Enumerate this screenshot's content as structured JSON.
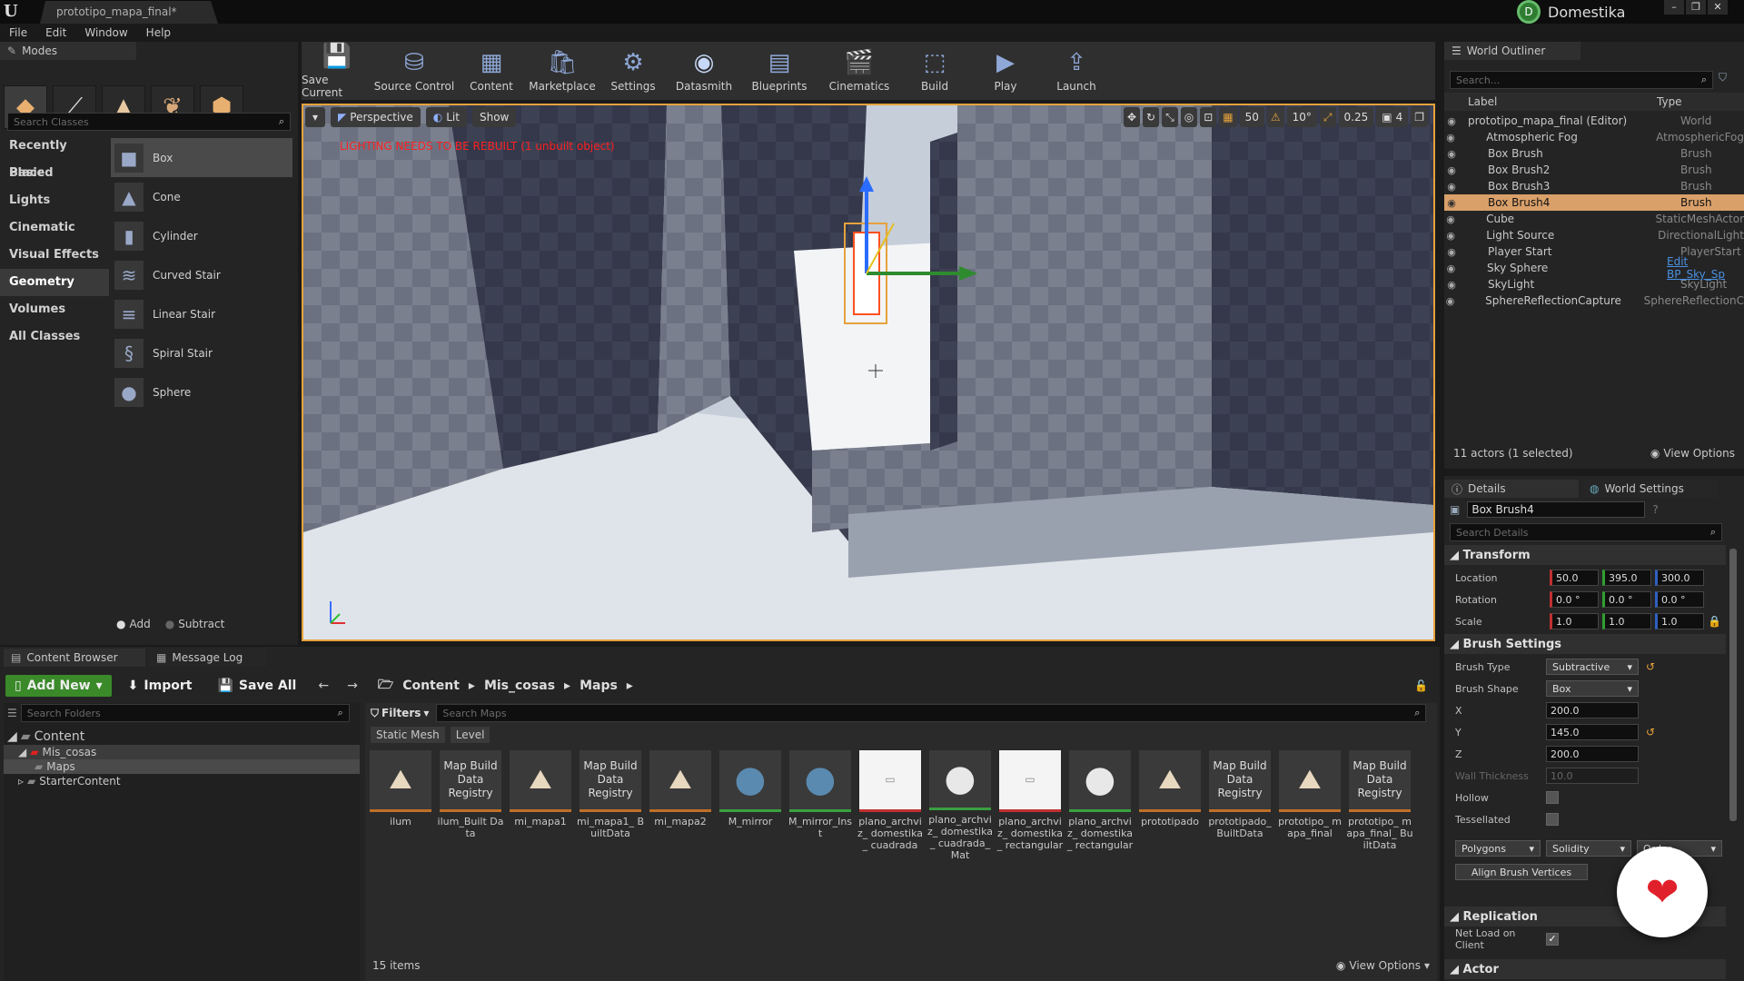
{
  "window": {
    "tab_title": "prototipo_mapa_final*",
    "brand": "Domestika",
    "brand_logo": "D",
    "logo": "U"
  },
  "menu": [
    "File",
    "Edit",
    "Window",
    "Help"
  ],
  "modes": {
    "tab": "Modes",
    "search_placeholder": "Search Classes",
    "categories": [
      "Recently Placed",
      "Basic",
      "Lights",
      "Cinematic",
      "Visual Effects",
      "Geometry",
      "Volumes",
      "All Classes"
    ],
    "active_category": "Geometry",
    "items": [
      "Box",
      "Cone",
      "Cylinder",
      "Curved Stair",
      "Linear Stair",
      "Spiral Stair",
      "Sphere"
    ],
    "add_label": "Add",
    "subtract_label": "Subtract"
  },
  "toolbar": {
    "buttons": [
      "Save Current",
      "Source Control",
      "Content",
      "Marketplace",
      "Settings",
      "Datasmith",
      "Blueprints",
      "Cinematics",
      "Build",
      "Play",
      "Launch"
    ]
  },
  "viewport": {
    "perspective": "Perspective",
    "lit": "Lit",
    "show": "Show",
    "warning": "LIGHTING NEEDS TO BE REBUILT (1 unbuilt object)",
    "grid_snap": "50",
    "rotation_snap": "10°",
    "scale_snap": "0.25",
    "camera_speed": "4"
  },
  "outliner": {
    "tab": "World Outliner",
    "search_placeholder": "Search...",
    "col_label": "Label",
    "col_type": "Type",
    "rows": [
      {
        "label": "prototipo_mapa_final (Editor)",
        "type": "World"
      },
      {
        "label": "Atmospheric Fog",
        "type": "AtmosphericFog"
      },
      {
        "label": "Box Brush",
        "type": "Brush"
      },
      {
        "label": "Box Brush2",
        "type": "Brush"
      },
      {
        "label": "Box Brush3",
        "type": "Brush"
      },
      {
        "label": "Box Brush4",
        "type": "Brush"
      },
      {
        "label": "Cube",
        "type": "StaticMeshActor"
      },
      {
        "label": "Light Source",
        "type": "DirectionalLight"
      },
      {
        "label": "Player Start",
        "type": "PlayerStart"
      },
      {
        "label": "Sky Sphere",
        "type": "Edit BP_Sky_Sp"
      },
      {
        "label": "SkyLight",
        "type": "SkyLight"
      },
      {
        "label": "SphereReflectionCapture",
        "type": "SphereReflectionC"
      }
    ],
    "footer": "11 actors (1 selected)",
    "view_options": "View Options"
  },
  "details": {
    "tab": "Details",
    "tab2": "World Settings",
    "name": "Box Brush4",
    "search_placeholder": "Search Details",
    "transform": "Transform",
    "location": "Location",
    "location_values": [
      "50.0",
      "395.0",
      "300.0"
    ],
    "rotation": "Rotation",
    "rotation_values": [
      "0.0 °",
      "0.0 °",
      "0.0 °"
    ],
    "scale": "Scale",
    "scale_values": [
      "1.0",
      "1.0",
      "1.0"
    ],
    "brush_settings": "Brush Settings",
    "brush_type_label": "Brush Type",
    "brush_type": "Subtractive",
    "brush_shape_label": "Brush Shape",
    "brush_shape": "Box",
    "x_label": "X",
    "x_value": "200.0",
    "y_label": "Y",
    "y_value": "145.0",
    "z_label": "Z",
    "z_value": "200.0",
    "wall_thickness_label": "Wall Thickness",
    "wall_thickness": "10.0",
    "hollow_label": "Hollow",
    "tessellated_label": "Tessellated",
    "polygons": "Polygons",
    "solidity": "Solidity",
    "order": "Order",
    "align_brush": "Align Brush Vertices",
    "replication": "Replication",
    "net_load_label": "Net Load on Client",
    "actor": "Actor"
  },
  "content_browser": {
    "tab": "Content Browser",
    "tab2": "Message Log",
    "add_new": "Add New",
    "import": "Import",
    "save_all": "Save All",
    "path": [
      "Content",
      "Mis_cosas",
      "Maps"
    ],
    "search_folders": "Search Folders",
    "filters": "Filters",
    "search_maps": "Search Maps",
    "filter_chips": [
      "Static Mesh",
      "Level"
    ],
    "folders": [
      "Content",
      "Mis_cosas",
      "Maps",
      "StarterContent"
    ],
    "assets": [
      {
        "name": "ilum",
        "thumb": ""
      },
      {
        "name": "ilum_Built Data",
        "thumb": "Map Build Data Registry"
      },
      {
        "name": "mi_mapa1",
        "thumb": ""
      },
      {
        "name": "mi_mapa1_ BuiltData",
        "thumb": "Map Build Data Registry"
      },
      {
        "name": "mi_mapa2",
        "thumb": ""
      },
      {
        "name": "M_mirror",
        "thumb": ""
      },
      {
        "name": "M_mirror_Inst",
        "thumb": ""
      },
      {
        "name": "plano_archviz_ domestika_ cuadrada",
        "thumb": ""
      },
      {
        "name": "plano_archviz_ domestika_ cuadrada_Mat",
        "thumb": ""
      },
      {
        "name": "plano_archviz_ domestika_ rectangular",
        "thumb": ""
      },
      {
        "name": "plano_archviz_ domestika_ rectangular",
        "thumb": ""
      },
      {
        "name": "prototipado",
        "thumb": ""
      },
      {
        "name": "prototipado_ BuiltData",
        "thumb": "Map Build Data Registry"
      },
      {
        "name": "prototipo_ mapa_final",
        "thumb": ""
      },
      {
        "name": "prototipo_ mapa_final_ BuiltData",
        "thumb": "Map Build Data Registry"
      }
    ],
    "item_count": "15 items",
    "view_options": "View Options"
  }
}
